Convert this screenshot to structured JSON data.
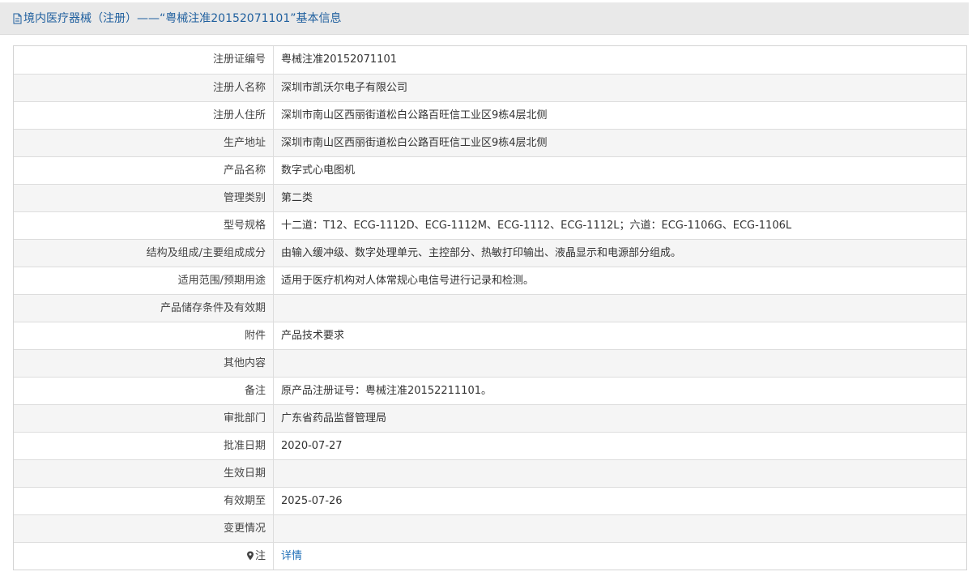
{
  "header": {
    "title": "境内医疗器械（注册）——“粤械注准20152071101”基本信息",
    "icon": "document-icon"
  },
  "rows": [
    {
      "label": "注册证编号",
      "value": "粤械注准20152071101"
    },
    {
      "label": "注册人名称",
      "value": "深圳市凯沃尔电子有限公司"
    },
    {
      "label": "注册人住所",
      "value": "深圳市南山区西丽街道松白公路百旺信工业区9栋4层北侧"
    },
    {
      "label": "生产地址",
      "value": "深圳市南山区西丽街道松白公路百旺信工业区9栋4层北侧"
    },
    {
      "label": "产品名称",
      "value": "数字式心电图机"
    },
    {
      "label": "管理类别",
      "value": "第二类"
    },
    {
      "label": "型号规格",
      "value": "十二道：T12、ECG-1112D、ECG-1112M、ECG-1112、ECG-1112L；六道：ECG-1106G、ECG-1106L"
    },
    {
      "label": "结构及组成/主要组成成分",
      "value": "由输入缓冲级、数字处理单元、主控部分、热敏打印输出、液晶显示和电源部分组成。"
    },
    {
      "label": "适用范围/预期用途",
      "value": "适用于医疗机构对人体常规心电信号进行记录和检测。"
    },
    {
      "label": "产品储存条件及有效期",
      "value": ""
    },
    {
      "label": "附件",
      "value": "产品技术要求"
    },
    {
      "label": "其他内容",
      "value": ""
    },
    {
      "label": "备注",
      "value": "原产品注册证号：粤械注准20152211101。"
    },
    {
      "label": "审批部门",
      "value": "广东省药品监督管理局"
    },
    {
      "label": "批准日期",
      "value": "2020-07-27"
    },
    {
      "label": "生效日期",
      "value": ""
    },
    {
      "label": "有效期至",
      "value": "2025-07-26"
    },
    {
      "label": "变更情况",
      "value": ""
    }
  ],
  "note_row": {
    "label": "注",
    "icon": "pin-icon",
    "link_text": "详情"
  },
  "colors": {
    "title": "#1f5f9e",
    "link": "#1f6fb8",
    "header_bg": "#e9e9e9",
    "stripe": "#f5f5f5"
  }
}
